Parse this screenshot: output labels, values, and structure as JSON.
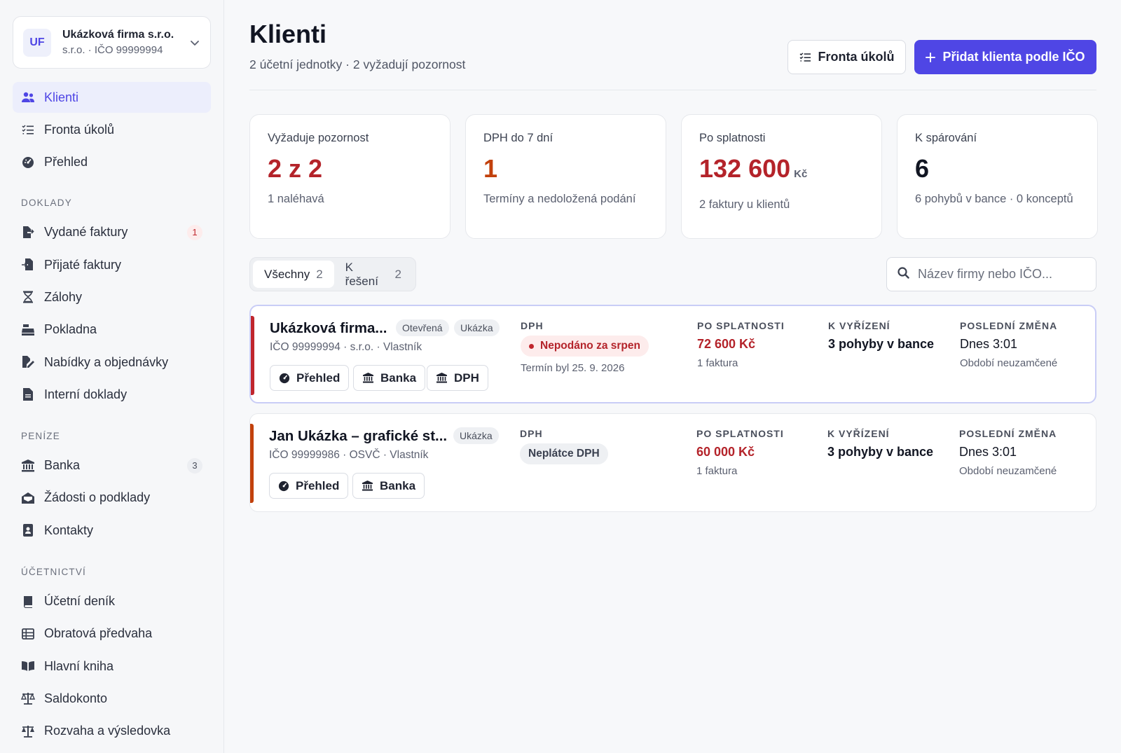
{
  "org": {
    "initials": "UF",
    "name": "Ukázková firma s.r.o.",
    "subtitle": "s.r.o. · IČO 99999994"
  },
  "nav": {
    "top": [
      {
        "label": "Klienti",
        "icon": "users-icon",
        "active": true
      },
      {
        "label": "Fronta úkolů",
        "icon": "list-check-icon"
      },
      {
        "label": "Přehled",
        "icon": "gauge-icon"
      }
    ],
    "doklady_title": "DOKLADY",
    "doklady": [
      {
        "label": "Vydané faktury",
        "icon": "file-export-icon",
        "badge": "1"
      },
      {
        "label": "Přijaté faktury",
        "icon": "file-import-icon"
      },
      {
        "label": "Zálohy",
        "icon": "hourglass-icon"
      },
      {
        "label": "Pokladna",
        "icon": "cash-register-icon"
      },
      {
        "label": "Nabídky a objednávky",
        "icon": "file-signature-icon"
      },
      {
        "label": "Interní doklady",
        "icon": "file-lines-icon"
      }
    ],
    "penize_title": "PENÍZE",
    "penize": [
      {
        "label": "Banka",
        "icon": "bank-icon",
        "badge": "3"
      },
      {
        "label": "Žádosti o podklady",
        "icon": "envelope-open-icon"
      },
      {
        "label": "Kontakty",
        "icon": "address-book-icon"
      }
    ],
    "ucetnictvi_title": "ÚČETNICTVÍ",
    "ucetnictvi": [
      {
        "label": "Účetní deník",
        "icon": "book-icon"
      },
      {
        "label": "Obratová předvaha",
        "icon": "table-list-icon"
      },
      {
        "label": "Hlavní kniha",
        "icon": "book-open-icon"
      },
      {
        "label": "Saldokonto",
        "icon": "scale-icon"
      },
      {
        "label": "Rozvaha a výsledovka",
        "icon": "scale-balanced-icon"
      }
    ]
  },
  "header": {
    "title": "Klienti",
    "subtitle": "2 účetní jednotky · 2 vyžadují pozornost",
    "queue_button": "Fronta úkolů",
    "add_button": "Přidat klienta podle IČO"
  },
  "stats": [
    {
      "label": "Vyžaduje pozornost",
      "value": "2 z 2",
      "unit": "",
      "note": "1 naléhavá",
      "color": "#b4232a"
    },
    {
      "label": "DPH do 7 dní",
      "value": "1",
      "unit": "",
      "note": "Termíny a nedoložená podání",
      "color": "#c2410c"
    },
    {
      "label": "Po splatnosti",
      "value": "132 600",
      "unit": "Kč",
      "note": "2 faktury u klientů",
      "color": "#b4232a"
    },
    {
      "label": "K spárování",
      "value": "6",
      "unit": "",
      "note": "6 pohybů v bance · 0 konceptů",
      "color": "#111522"
    }
  ],
  "tabs": [
    {
      "label": "Všechny",
      "count": "2",
      "active": true
    },
    {
      "label": "K řešení",
      "count": "2"
    }
  ],
  "search": {
    "placeholder": "Název firmy nebo IČO..."
  },
  "columns": {
    "dph": "DPH",
    "overdue": "PO SPLATNOSTI",
    "pending": "K VYŘÍZENÍ",
    "last_change": "POSLEDNÍ ZMĚNA"
  },
  "clients": [
    {
      "name": "Ukázková firma...",
      "chips": [
        "Otevřená",
        "Ukázka"
      ],
      "meta": "IČO 99999994 · s.r.o. · Vlastník",
      "actions": [
        "Přehled",
        "Banka",
        "DPH"
      ],
      "dph_status": "Nepodáno za srpen",
      "dph_note": "Termín byl 25. 9. 2026",
      "overdue": "72 600 Kč",
      "overdue_note": "1 faktura",
      "pending": "3 pohyby v bance",
      "last_change": "Dnes 3:01",
      "last_change_note": "Období neuzamčené",
      "accent": "#c0262d"
    },
    {
      "name": "Jan Ukázka – grafické st...",
      "chips": [
        "Ukázka"
      ],
      "meta": "IČO 99999986 · OSVČ · Vlastník",
      "actions": [
        "Přehled",
        "Banka"
      ],
      "dph_status": "Neplátce DPH",
      "overdue": "60 000 Kč",
      "overdue_note": "1 faktura",
      "pending": "3 pohyby v bance",
      "last_change": "Dnes 3:01",
      "last_change_note": "Období neuzamčené",
      "accent": "#c2410c"
    }
  ],
  "colors": {
    "accent": "#4f46e5",
    "danger": "#b4232a",
    "warning": "#c2410c"
  }
}
